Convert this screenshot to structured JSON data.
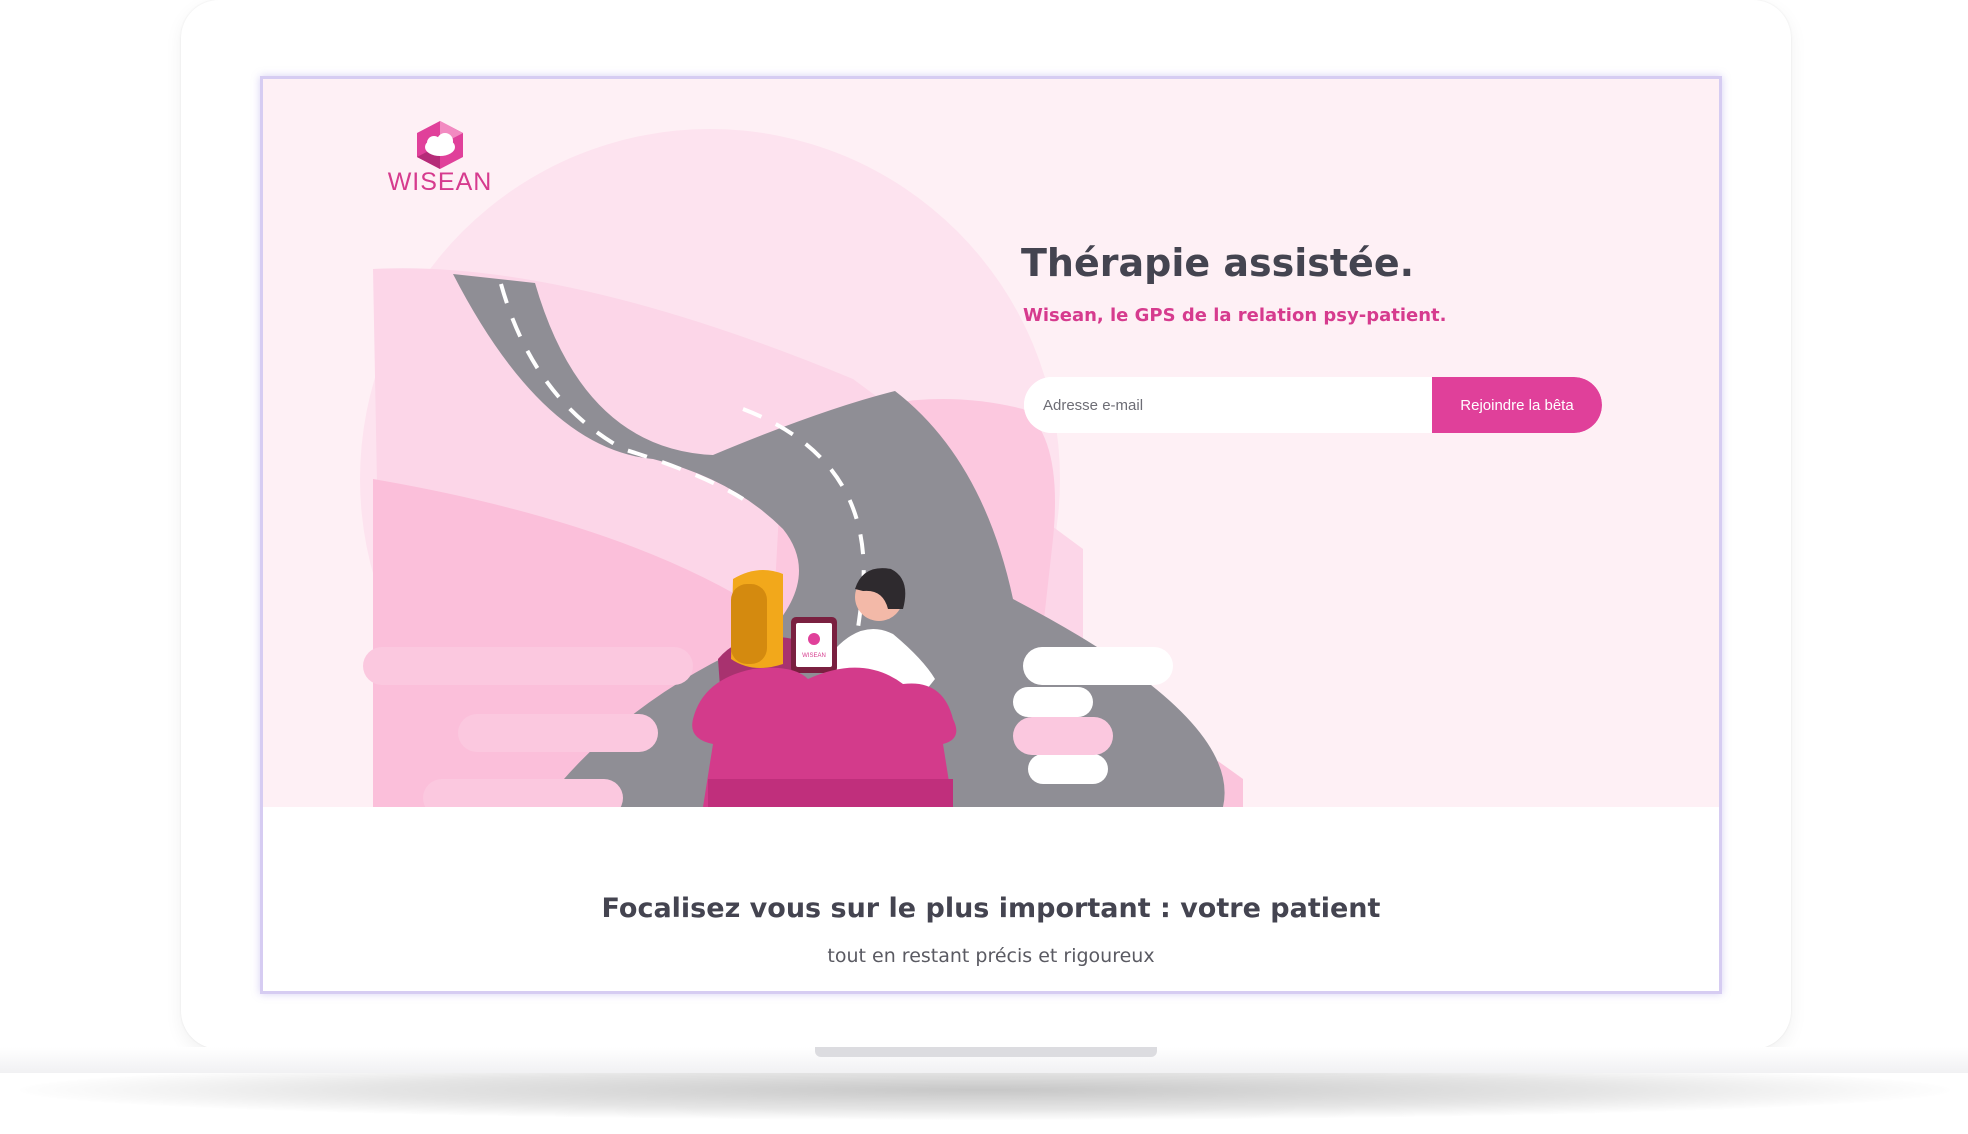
{
  "brand": {
    "name": "WISEAN",
    "accent_color": "#e0409a",
    "logo_icon": "cloud-hexagon-logo"
  },
  "hero": {
    "headline": "Thérapie assistée.",
    "subheadline": "Wisean, le GPS de la relation psy-patient.",
    "background_color": "#fef0f5",
    "illustration": "road-couch-therapy-illustration",
    "tablet_label": "WISEAN"
  },
  "signup": {
    "email_placeholder": "Adresse e-mail",
    "button_label": "Rejoindre la bêta"
  },
  "section": {
    "title": "Focalisez vous sur le plus important : votre patient",
    "subtitle": "tout en restant précis et rigoureux"
  }
}
